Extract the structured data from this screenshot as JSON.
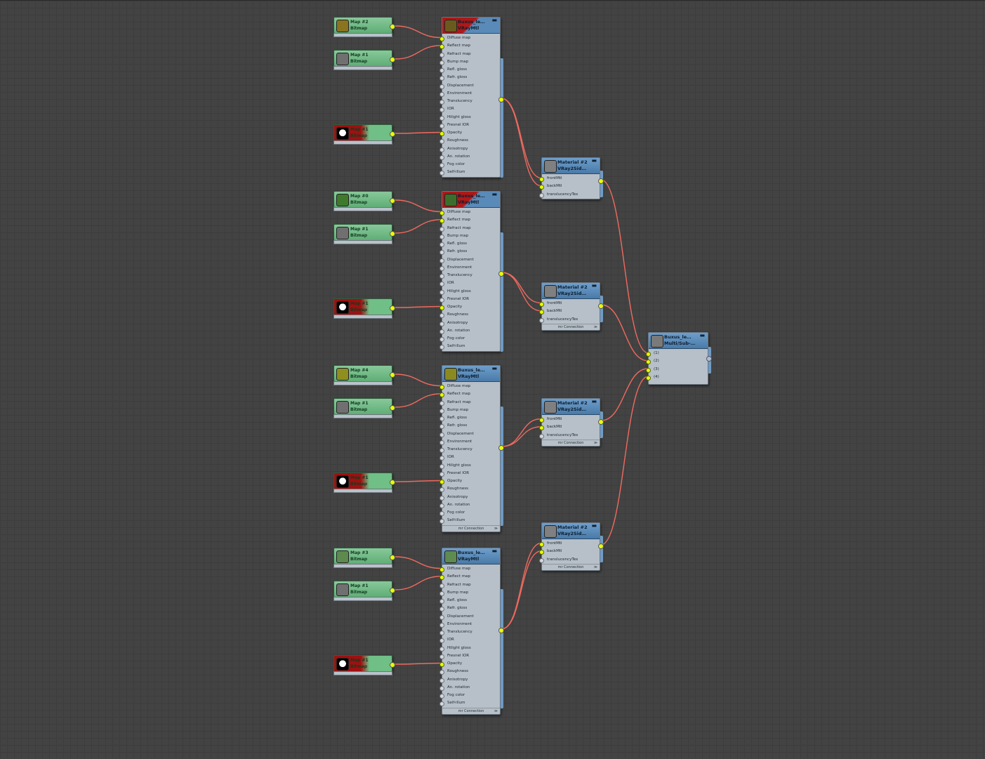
{
  "slot_labels": [
    "Diffuse map",
    "Reflect map",
    "Refract map",
    "Bump map",
    "Refl. gloss",
    "Refr. gloss",
    "Displacement",
    "Environment",
    "Translucency",
    "IOR",
    "Hilight gloss",
    "Fresnel IOR",
    "Opacity",
    "Roughness",
    "Anisotropy",
    "An. rotation",
    "Fog color",
    "Self-illum"
  ],
  "twosided_slots": [
    "frontMtl",
    "backMtl",
    "translucencyTex"
  ],
  "multi_slots": [
    "(1)",
    "(2)",
    "(3)",
    "(4)"
  ],
  "minimize_glyph": "▬",
  "footer": {
    "label": "mr Connection",
    "arrow": "≫"
  },
  "groups": [
    {
      "vray": {
        "n1": "Buxus_le…",
        "n2": "VRayMtl",
        "red": true,
        "thumb": "#6b5a1e",
        "footer": false
      },
      "bitmaps": [
        {
          "n1": "Map #2",
          "n2": "Bitmap",
          "thumb": "#8a7420"
        },
        {
          "n1": "Map #1",
          "n2": "Bitmap",
          "thumb": "#707070"
        },
        {
          "n1": "Map #1",
          "n2": "Bitmap",
          "opacity": true
        }
      ]
    },
    {
      "vray": {
        "n1": "Buxus_le…",
        "n2": "VRayMtl",
        "red": true,
        "thumb": "#3b6e2a",
        "footer": false
      },
      "bitmaps": [
        {
          "n1": "Map #0",
          "n2": "Bitmap",
          "thumb": "#3f7a2c"
        },
        {
          "n1": "Map #1",
          "n2": "Bitmap",
          "thumb": "#707070"
        },
        {
          "n1": "Map #1",
          "n2": "Bitmap",
          "opacity": true
        }
      ]
    },
    {
      "vray": {
        "n1": "Buxus_le…",
        "n2": "VRayMtl",
        "red": false,
        "thumb": "#8a8a20",
        "footer": true
      },
      "bitmaps": [
        {
          "n1": "Map #4",
          "n2": "Bitmap",
          "thumb": "#8e8f1e"
        },
        {
          "n1": "Map #1",
          "n2": "Bitmap",
          "thumb": "#707070"
        },
        {
          "n1": "Map #1",
          "n2": "Bitmap",
          "opacity": true
        }
      ]
    },
    {
      "vray": {
        "n1": "Buxus_le…",
        "n2": "VRayMtl",
        "red": false,
        "thumb": "#5f8a50",
        "footer": true
      },
      "bitmaps": [
        {
          "n1": "Map #3",
          "n2": "Bitmap",
          "thumb": "#5e8a4e"
        },
        {
          "n1": "Map #1",
          "n2": "Bitmap",
          "thumb": "#707070"
        },
        {
          "n1": "Map #1",
          "n2": "Bitmap",
          "opacity": true
        }
      ]
    }
  ],
  "twosided": [
    {
      "n1": "Material #2",
      "n2": "VRay2Sid…",
      "footer": false
    },
    {
      "n1": "Material #2",
      "n2": "VRay2Sid…",
      "footer": true
    },
    {
      "n1": "Material #2",
      "n2": "VRay2Sid…",
      "footer": true
    },
    {
      "n1": "Material #2",
      "n2": "VRay2Sid…",
      "footer": true
    }
  ],
  "multi": {
    "n1": "Buxus_le…",
    "n2": "Multi/Sub-…"
  },
  "colors": {
    "wire": "#f06a5e",
    "socket": "#eaff00",
    "header": "#5a8ab8",
    "bitmap": "#6fbf86"
  }
}
